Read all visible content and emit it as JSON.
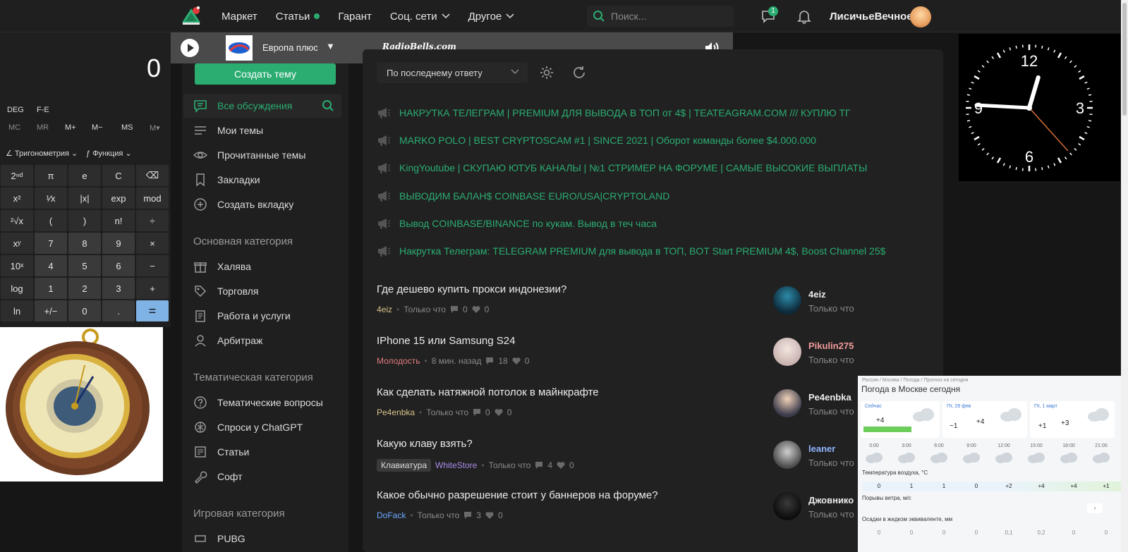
{
  "nav": {
    "items": [
      "Маркет",
      "Статьи",
      "Гарант",
      "Соц. сети",
      "Другое"
    ],
    "search_placeholder": "Поиск...",
    "messages_badge": "1",
    "username": "ЛисичьеВечное"
  },
  "radio": {
    "station": "Европа плюс",
    "caret": "▼",
    "brand": "RadioBells.com"
  },
  "calc": {
    "display": "0",
    "mode_deg": "DEG",
    "mode_fe": "F-E",
    "memory": [
      "MC",
      "MR",
      "M+",
      "M−",
      "MS",
      "M▾"
    ],
    "trig": "Тригонометрия",
    "func": "Функция",
    "keys": [
      "2ⁿᵈ",
      "π",
      "e",
      "C",
      "⌫",
      "x²",
      "¹⁄x",
      "|x|",
      "exp",
      "mod",
      "²√x",
      "(",
      ")",
      "n!",
      "÷",
      "xʸ",
      "7",
      "8",
      "9",
      "×",
      "10ˣ",
      "4",
      "5",
      "6",
      "−",
      "log",
      "1",
      "2",
      "3",
      "+",
      "ln",
      "+/−",
      "0",
      ".",
      "="
    ]
  },
  "sidebar": {
    "create_button": "Создать тему",
    "items": [
      "Все обсуждения",
      "Мои темы",
      "Прочитанные темы",
      "Закладки",
      "Создать вкладку"
    ],
    "head_main": "Основная категория",
    "main_items": [
      "Халява",
      "Торговля",
      "Работа и услуги",
      "Арбитраж"
    ],
    "head_theme": "Тематическая категория",
    "theme_items": [
      "Тематические вопросы",
      "Спроси у ChatGPT",
      "Статьи",
      "Софт"
    ],
    "head_game": "Игровая категория",
    "game_items": [
      "PUBG"
    ]
  },
  "main": {
    "sort": "По последнему ответу",
    "pinned": [
      "НАКРУТКА ТЕЛЕГРАМ | PREMIUM ДЛЯ ВЫВОДА В ТОП от 4$ | TEATEAGRAM.COM /// КУПЛЮ ТГ",
      "MARKO POLO | BEST CRYPTOSCAM #1 | SINCE 2021 | Оборот команды более $4.000.000",
      "KingYoutube | СКУПАЮ ЮТУБ КАНАЛЫ | №1 СТРИМЕР НА ФОРУМЕ | САМЫЕ ВЫСОКИЕ ВЫПЛАТЫ",
      "ВЫВОДИМ БАЛАН$ COINBASE EURO/USA|CRYPTOLAND",
      "Вывод COINBASE/BINANCE по кукам. Вывод в теч часа",
      "Накрутка Телеграм: TELEGRAM PREMIUM для вывода в ТОП, BOT Start PREMIUM 4$, Boost Channel 25$"
    ],
    "threads": [
      {
        "title": "Где дешево купить прокси индонезии?",
        "tag": "",
        "author": "4eiz",
        "author_color": "#d8c08a",
        "time": "Только что",
        "replies": "0",
        "likes": "0",
        "last_name": "4eiz",
        "last_color": "#ececec",
        "last_time": "Только что"
      },
      {
        "title": "IPhone 15 или Samsung S24",
        "tag": "",
        "author": "Молодость",
        "author_color": "#e07b7b",
        "time": "8 мин. назад",
        "replies": "18",
        "likes": "0",
        "last_name": "Pikulin275",
        "last_color": "#f29a9a",
        "last_time": "Только что"
      },
      {
        "title": "Как сделать натяжной потолок в майнкрафте",
        "tag": "",
        "author": "Pe4enbka",
        "author_color": "#d8c08a",
        "time": "Только что",
        "replies": "0",
        "likes": "0",
        "last_name": "Pe4enbka",
        "last_color": "#ececec",
        "last_time": "Только что"
      },
      {
        "title": "Какую клаву взять?",
        "tag": "Клавиатура",
        "author": "WhiteStore",
        "author_color": "#a98be8",
        "time": "Только что",
        "replies": "4",
        "likes": "0",
        "last_name": "leaner",
        "last_color": "#8fb4ff",
        "last_time": "Только что"
      },
      {
        "title": "Какое обычно разрешение стоит у баннеров на форуме?",
        "tag": "",
        "author": "DoFack",
        "author_color": "#6aa8ff",
        "time": "Только что",
        "replies": "3",
        "likes": "0",
        "last_name": "Джовнико",
        "last_color": "#ececec",
        "last_time": "Только что"
      }
    ]
  },
  "clock": {
    "n12": "12",
    "n3": "3",
    "n6": "6",
    "n9": "9",
    "hour": 0.55,
    "minute": 45.5,
    "second": 23
  },
  "weather": {
    "crumb": "Россия / Москва / Погода / Прогноз на сегодня",
    "title": "Погода в Москве сегодня",
    "cards": [
      {
        "label": "Сейчас",
        "t1": "+4",
        "t2": ""
      },
      {
        "label": "Пт, 29 фев",
        "t1": "−1",
        "t2": "+4"
      },
      {
        "label": "Пт, 1 март",
        "t1": "+1",
        "t2": "+3"
      }
    ],
    "hours": [
      "0:00",
      "3:00",
      "6:00",
      "9:00",
      "12:00",
      "15:00",
      "18:00",
      "21:00"
    ],
    "temp_label": "Температура воздуха, °С",
    "temps": [
      "0",
      "1",
      "1",
      "0",
      "+2",
      "+4",
      "+4",
      "+1"
    ],
    "wind_label": "Порывы ветра, м/с",
    "precip_label": "Осадки в жидком эквиваленте, мм",
    "precip": [
      "0",
      "0",
      "0",
      "0",
      "0,1",
      "0,2",
      "0",
      "0"
    ]
  }
}
